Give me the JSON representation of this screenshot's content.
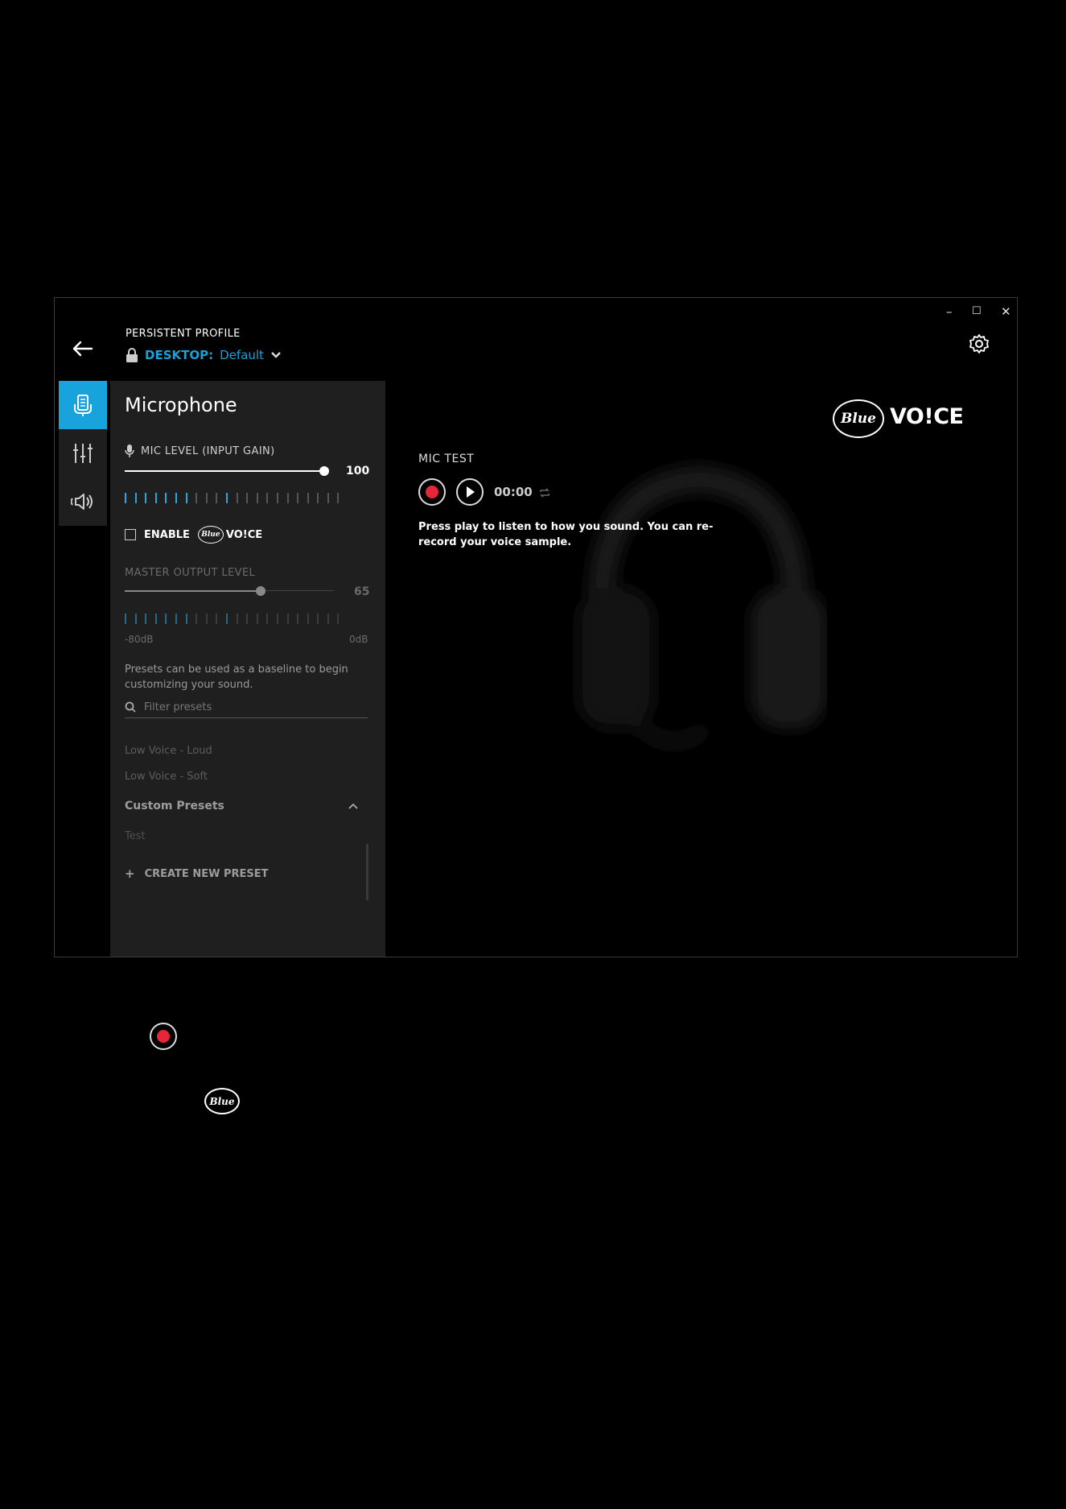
{
  "window_controls": {
    "minimize": "–",
    "maximize": "☐",
    "close": "✕"
  },
  "profile": {
    "label": "PERSISTENT PROFILE",
    "device": "DESKTOP:",
    "name": "Default"
  },
  "panel": {
    "title": "Microphone",
    "mic_level_label": "MIC LEVEL (INPUT GAIN)",
    "mic_level_value": "100",
    "mic_level_fraction": 1.0,
    "enable_label": "ENABLE",
    "voice_text": "VO!CE",
    "blue_text": "Blue",
    "master_label": "MASTER OUTPUT LEVEL",
    "master_value": "65",
    "master_fraction": 0.65,
    "db_min": "-80dB",
    "db_max": "0dB",
    "presets_desc": "Presets can be used as a baseline to begin customizing your sound.",
    "filter_placeholder": "Filter presets",
    "presets": [
      "Low Voice - Loud",
      "Low Voice - Soft"
    ],
    "custom_header": "Custom Presets",
    "custom_presets": [
      "Test"
    ],
    "create_label": "CREATE NEW PRESET"
  },
  "mic_test": {
    "title": "MIC TEST",
    "time": "00:00",
    "desc_line1": "Press play to listen to how you sound. You can re-",
    "desc_line2": "record your voice sample."
  },
  "brand": {
    "blue": "Blue",
    "voice": "VO!CE"
  },
  "colors": {
    "accent": "#18a3dc",
    "record": "#e8263a",
    "panel": "#1f1f1f"
  }
}
